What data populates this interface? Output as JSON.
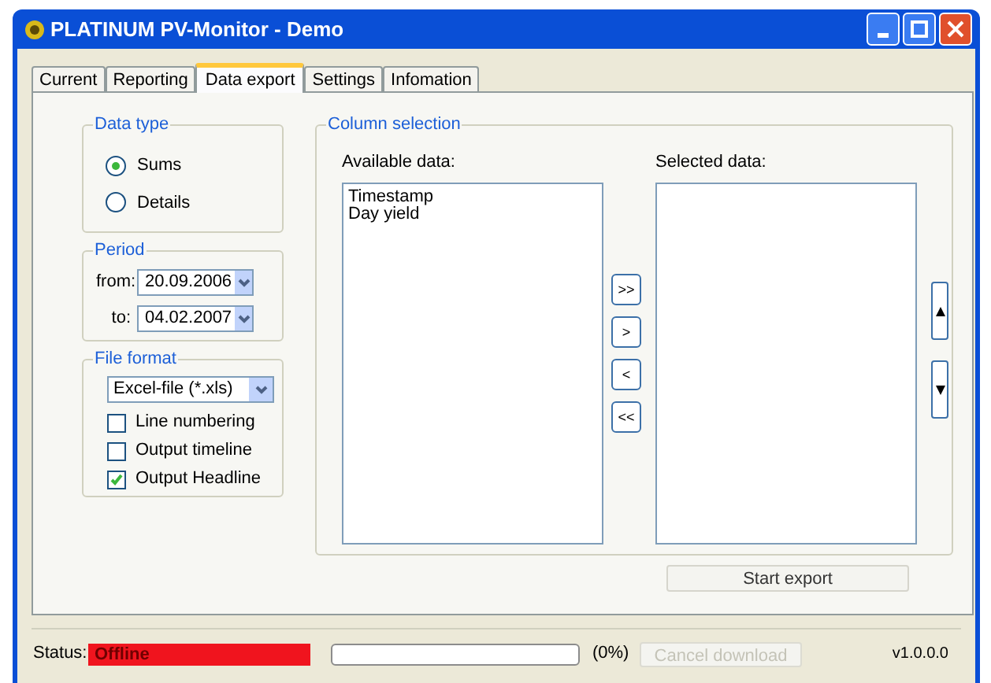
{
  "window": {
    "title": "PLATINUM PV-Monitor - Demo"
  },
  "tabs": [
    {
      "label": "Current",
      "selected": false
    },
    {
      "label": "Reporting",
      "selected": false
    },
    {
      "label": "Data export",
      "selected": true
    },
    {
      "label": "Settings",
      "selected": false
    },
    {
      "label": "Infomation",
      "selected": false
    }
  ],
  "data_type": {
    "title": "Data type",
    "options": [
      {
        "label": "Sums",
        "selected": true
      },
      {
        "label": "Details",
        "selected": false
      }
    ]
  },
  "period": {
    "title": "Period",
    "from": {
      "label": "from:",
      "value": "20.09.2006"
    },
    "to": {
      "label": "to:",
      "value": "04.02.2007"
    }
  },
  "file_format": {
    "title": "File format",
    "value": "Excel-file (*.xls)",
    "options": [
      {
        "label": "Line numbering",
        "checked": false
      },
      {
        "label": "Output timeline",
        "checked": false
      },
      {
        "label": "Output Headline",
        "checked": true
      }
    ]
  },
  "column_selection": {
    "title": "Column selection",
    "available_label": "Available data:",
    "available": [
      "Timestamp",
      "Day yield"
    ],
    "selected_label": "Selected data:",
    "transfer_buttons": [
      ">>",
      ">",
      "<",
      "<<"
    ],
    "start_button": "Start export"
  },
  "status_bar": {
    "label": "Status:",
    "value": "Offline",
    "progress": {
      "level": 0,
      "reading": "(0%)"
    },
    "cancel_button": {
      "label": "Cancel download",
      "disabled": true
    },
    "version": "v1.0.0.0"
  }
}
